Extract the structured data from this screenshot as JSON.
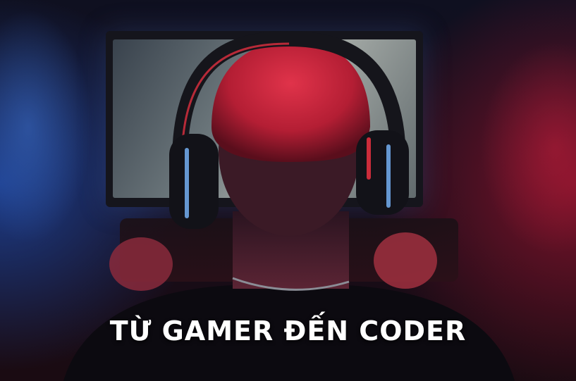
{
  "banner": {
    "title": "TỪ GAMER ĐẾN CODER"
  },
  "scene": {
    "subject": "person-wearing-gaming-headset-at-computer",
    "colors": {
      "blue_light": "#2f5fc0",
      "red_light": "#c4203c",
      "hair": "#c2243a"
    }
  }
}
